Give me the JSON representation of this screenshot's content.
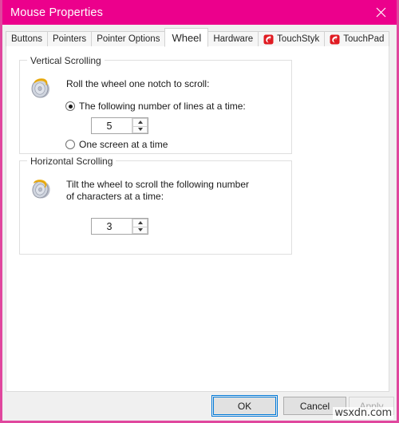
{
  "window": {
    "title": "Mouse Properties",
    "close_icon": "close-icon",
    "titlebar_color": "#ec008c",
    "border_color": "#e0479e"
  },
  "tabs": [
    {
      "label": "Buttons",
      "selected": false,
      "icon": null
    },
    {
      "label": "Pointers",
      "selected": false,
      "icon": null
    },
    {
      "label": "Pointer Options",
      "selected": false,
      "icon": null
    },
    {
      "label": "Wheel",
      "selected": true,
      "icon": null
    },
    {
      "label": "Hardware",
      "selected": false,
      "icon": null
    },
    {
      "label": "TouchStyk",
      "selected": false,
      "icon": "touchstyk-logo-icon"
    },
    {
      "label": "TouchPad",
      "selected": false,
      "icon": "touchpad-logo-icon"
    }
  ],
  "vertical_scrolling": {
    "group_title": "Vertical Scrolling",
    "icon": "mouse-wheel-vertical-icon",
    "prompt": "Roll the wheel one notch to scroll:",
    "options": [
      {
        "label": "The following number of lines at a time:",
        "checked": true
      },
      {
        "label": "One screen at a time",
        "checked": false
      }
    ],
    "spinner": {
      "value": "5",
      "up_icon": "spin-up-arrow-icon",
      "down_icon": "spin-down-arrow-icon"
    }
  },
  "horizontal_scrolling": {
    "group_title": "Horizontal Scrolling",
    "icon": "mouse-wheel-horizontal-icon",
    "prompt_line1": "Tilt the wheel to scroll the following number",
    "prompt_line2": "of characters at a time:",
    "spinner": {
      "value": "3",
      "up_icon": "spin-up-arrow-icon",
      "down_icon": "spin-down-arrow-icon"
    }
  },
  "footer": {
    "ok_label": "OK",
    "cancel_label": "Cancel",
    "apply_label": "Apply",
    "apply_disabled": true,
    "focus_color": "#0078d7"
  },
  "watermark": "wsxdn.com"
}
